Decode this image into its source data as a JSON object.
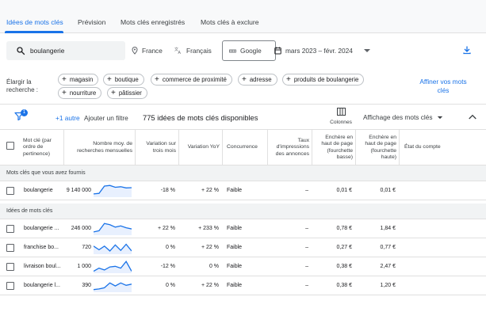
{
  "tabs": [
    {
      "label": "Idées de mots clés",
      "active": true
    },
    {
      "label": "Prévision"
    },
    {
      "label": "Mots clés enregistrés"
    },
    {
      "label": "Mots clés à exclure"
    }
  ],
  "search": {
    "value": "boulangerie",
    "icon": "search-icon"
  },
  "location": "France",
  "language": "Français",
  "network": "Google",
  "date_range": "mars 2023 – févr. 2024",
  "refine": {
    "label_line1": "Élargir la",
    "label_line2": "recherche :",
    "pills": [
      "magasin",
      "boutique",
      "commerce de proximité",
      "adresse",
      "produits de boulangerie",
      "nourriture",
      "pâtissier"
    ],
    "link_line1": "Affiner vos mots",
    "link_line2": "clés"
  },
  "filters": {
    "badge": "1",
    "more": "+1 autre",
    "add": "Ajouter un filtre",
    "count": "775 idées de mots clés disponibles",
    "columns": "Colonnes",
    "view": "Affichage des mots clés"
  },
  "columns": {
    "keyword": [
      "Mot clé (par",
      "ordre de",
      "pertinence)"
    ],
    "volume": [
      "Nombre moy. de",
      "recherches mensuelles"
    ],
    "trend3m": [
      "Variation sur",
      "trois mois"
    ],
    "yoy": [
      "Variation YoY"
    ],
    "competition": [
      "Concurrence"
    ],
    "impressions": [
      "Taux",
      "d'impressions",
      "des annonces"
    ],
    "bid_low": [
      "Enchère en",
      "haut de page",
      "(fourchette",
      "basse)"
    ],
    "bid_high": [
      "Enchère en",
      "haut de page",
      "(fourchette",
      "haute)"
    ],
    "status": [
      "État du compte"
    ]
  },
  "sections": {
    "provided": "Mots clés que vous avez fournis",
    "ideas": "Idées de mots clés"
  },
  "provided_rows": [
    {
      "keyword": "boulangerie",
      "volume": "9 140 000",
      "trend3m": "-18 %",
      "yoy": "+ 22 %",
      "competition": "Faible",
      "impressions": "–",
      "bid_low": "0,01 €",
      "bid_high": "0,01 €"
    }
  ],
  "idea_rows": [
    {
      "keyword": "boulangerie ...",
      "volume": "246 000",
      "trend3m": "+ 22 %",
      "yoy": "+ 233 %",
      "competition": "Faible",
      "impressions": "–",
      "bid_low": "0,78 €",
      "bid_high": "1,84 €"
    },
    {
      "keyword": "franchise bo...",
      "volume": "720",
      "trend3m": "0 %",
      "yoy": "+ 22 %",
      "competition": "Faible",
      "impressions": "–",
      "bid_low": "0,27 €",
      "bid_high": "0,77 €"
    },
    {
      "keyword": "livraison boul...",
      "volume": "1 000",
      "trend3m": "-12 %",
      "yoy": "0 %",
      "competition": "Faible",
      "impressions": "–",
      "bid_low": "0,38 €",
      "bid_high": "2,47 €"
    },
    {
      "keyword": "boulangerie l...",
      "volume": "390",
      "trend3m": "0 %",
      "yoy": "+ 22 %",
      "competition": "Faible",
      "impressions": "–",
      "bid_low": "0,38 €",
      "bid_high": "1,20 €"
    }
  ],
  "colors": {
    "accent": "#1a73e8",
    "sparkline": "#1a73e8",
    "sparkfill": "#e8f0fe"
  }
}
